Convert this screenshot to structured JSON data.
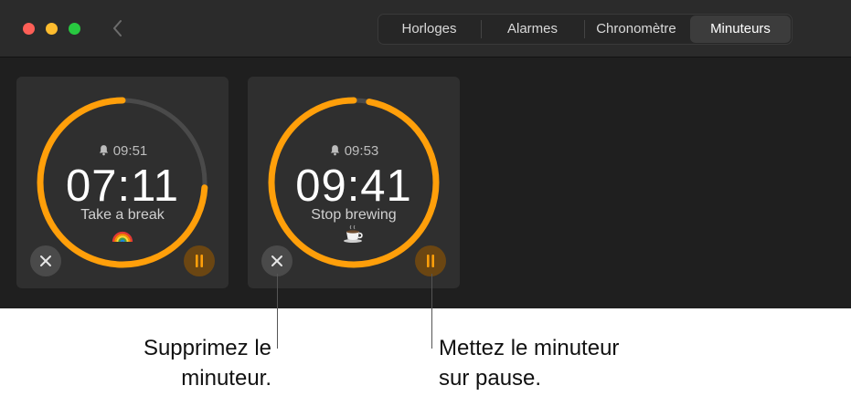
{
  "tabs": [
    {
      "label": "Horloges",
      "selected": false
    },
    {
      "label": "Alarmes",
      "selected": false
    },
    {
      "label": "Chronomètre",
      "selected": false
    },
    {
      "label": "Minuteurs",
      "selected": true
    }
  ],
  "timers": [
    {
      "alarm_time": "09:51",
      "remaining": "07:11",
      "label": "Take a break",
      "emoji_icon": "rainbow-icon",
      "progress": 0.74
    },
    {
      "alarm_time": "09:53",
      "remaining": "09:41",
      "label": "Stop brewing",
      "emoji_icon": "coffee-cup-icon",
      "progress": 0.97
    }
  ],
  "callouts": {
    "delete_line1": "Supprimez le",
    "delete_line2": "minuteur.",
    "pause_line1": "Mettez le minuteur",
    "pause_line2": "sur pause."
  },
  "colors": {
    "ring_active": "#ff9f0a",
    "ring_track": "#4a4a4a",
    "pause_button_bg": "#6b4612",
    "window_bg": "#1f1f1f"
  }
}
